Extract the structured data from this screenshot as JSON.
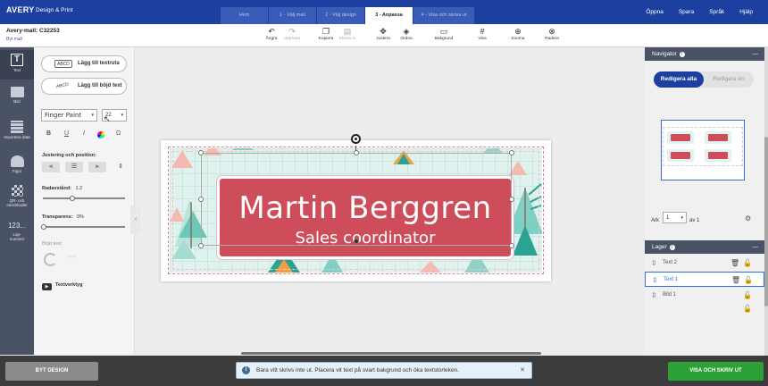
{
  "app": {
    "brand": "AVERY",
    "brand_sub": "Design & Print",
    "steps": [
      "Hem",
      "1 - Välj mall",
      "2 - Välj design",
      "3 - Anpassa",
      "4 - Visa och skriva ut"
    ],
    "active_step": "3 - Anpassa",
    "topnav": [
      "Öppna",
      "Spara",
      "Språk",
      "Hjälp"
    ],
    "accent_color": "#1c3fa0"
  },
  "toolbar": {
    "template_title": "Avery-mall: C32253",
    "template_link": "Byt mall",
    "undo": "Ångra",
    "redo": "Upprepa",
    "copy": "Kopiera",
    "paste": "Klistra in",
    "align": "Justera",
    "arrange": "Ordna",
    "background": "Bakgrund",
    "view": "Visa",
    "zoom": "Zooma",
    "delete": "Radera"
  },
  "rail": {
    "text": "Text",
    "image": "Bild",
    "import": "Importera data",
    "shape": "Figur",
    "qr": "QR- och streckkoder",
    "numbers_icon": "123...",
    "numbers": "Löp-nummer"
  },
  "text_panel": {
    "add_textbox": "Lägg till textruta",
    "add_textbox_icon": "ABCD",
    "add_curved": "Lägg till böjd text",
    "add_curved_icon": "ABCD",
    "font": "Finger Paint",
    "size": "22",
    "format_bold": "B",
    "format_underline": "U",
    "format_italic": "I",
    "format_special": "Ω",
    "align_label": "Justering och position:",
    "line_spacing_label": "Radavstånd:",
    "line_spacing_value": "1.2",
    "transparency_label": "Transparens:",
    "transparency_value": "0%",
    "curved_label": "Böjd text:",
    "tools_label": "Textverktyg"
  },
  "label": {
    "name": "Martin Berggren",
    "role": "Sales coordinator",
    "box_color": "#cd4d5b"
  },
  "footer": {
    "change_design": "BYT DESIGN",
    "show_print": "VISA OCH SKRIV UT",
    "toast": "Bara vitt skrivs inte ut. Placera vit text på svart bakgrund och öka textstorleken.",
    "toast_close": "✕"
  },
  "navigator": {
    "title": "Navigator",
    "edit_all": "Redigera alla",
    "edit_one": "Redigera en",
    "sheet_label": "Ark",
    "sheet_value": "1",
    "sheet_of": "av 1"
  },
  "layers": {
    "title": "Lager",
    "items": [
      "Text 2",
      "Text 1",
      "Bild 1"
    ],
    "selected": "Text 1"
  }
}
